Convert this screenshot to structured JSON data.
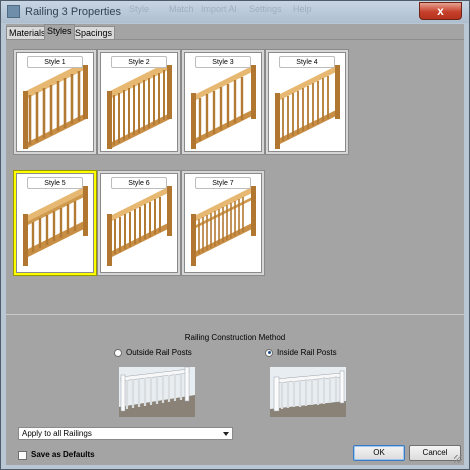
{
  "window": {
    "title": "Railing 3 Properties",
    "background_toolbar": [
      "Style",
      "Match",
      "Import Al",
      "Settings",
      "Help"
    ],
    "close_label": "x"
  },
  "tabs": [
    {
      "label": "Materials",
      "active": false
    },
    {
      "label": "Styles",
      "active": true
    },
    {
      "label": "Spacings",
      "active": false
    }
  ],
  "styles": {
    "items": [
      {
        "label": "Style 1",
        "selected": false
      },
      {
        "label": "Style 2",
        "selected": false
      },
      {
        "label": "Style 3",
        "selected": false
      },
      {
        "label": "Style 4",
        "selected": false
      },
      {
        "label": "Style 5",
        "selected": true
      },
      {
        "label": "Style 6",
        "selected": false
      },
      {
        "label": "Style 7",
        "selected": false
      }
    ]
  },
  "construction": {
    "title": "Railing Construction Method",
    "options": [
      {
        "label": "Outside Rail Posts",
        "checked": false
      },
      {
        "label": "Inside Rail Posts",
        "checked": true
      }
    ]
  },
  "apply_dropdown": {
    "value": "Apply to all Railings"
  },
  "save_defaults": {
    "label": "Save as Defaults",
    "checked": false
  },
  "buttons": {
    "ok": "OK",
    "cancel": "Cancel"
  },
  "colors": {
    "selection": "#ffff00",
    "wood": "#d9a55a",
    "panel": "#a4a4a4"
  }
}
